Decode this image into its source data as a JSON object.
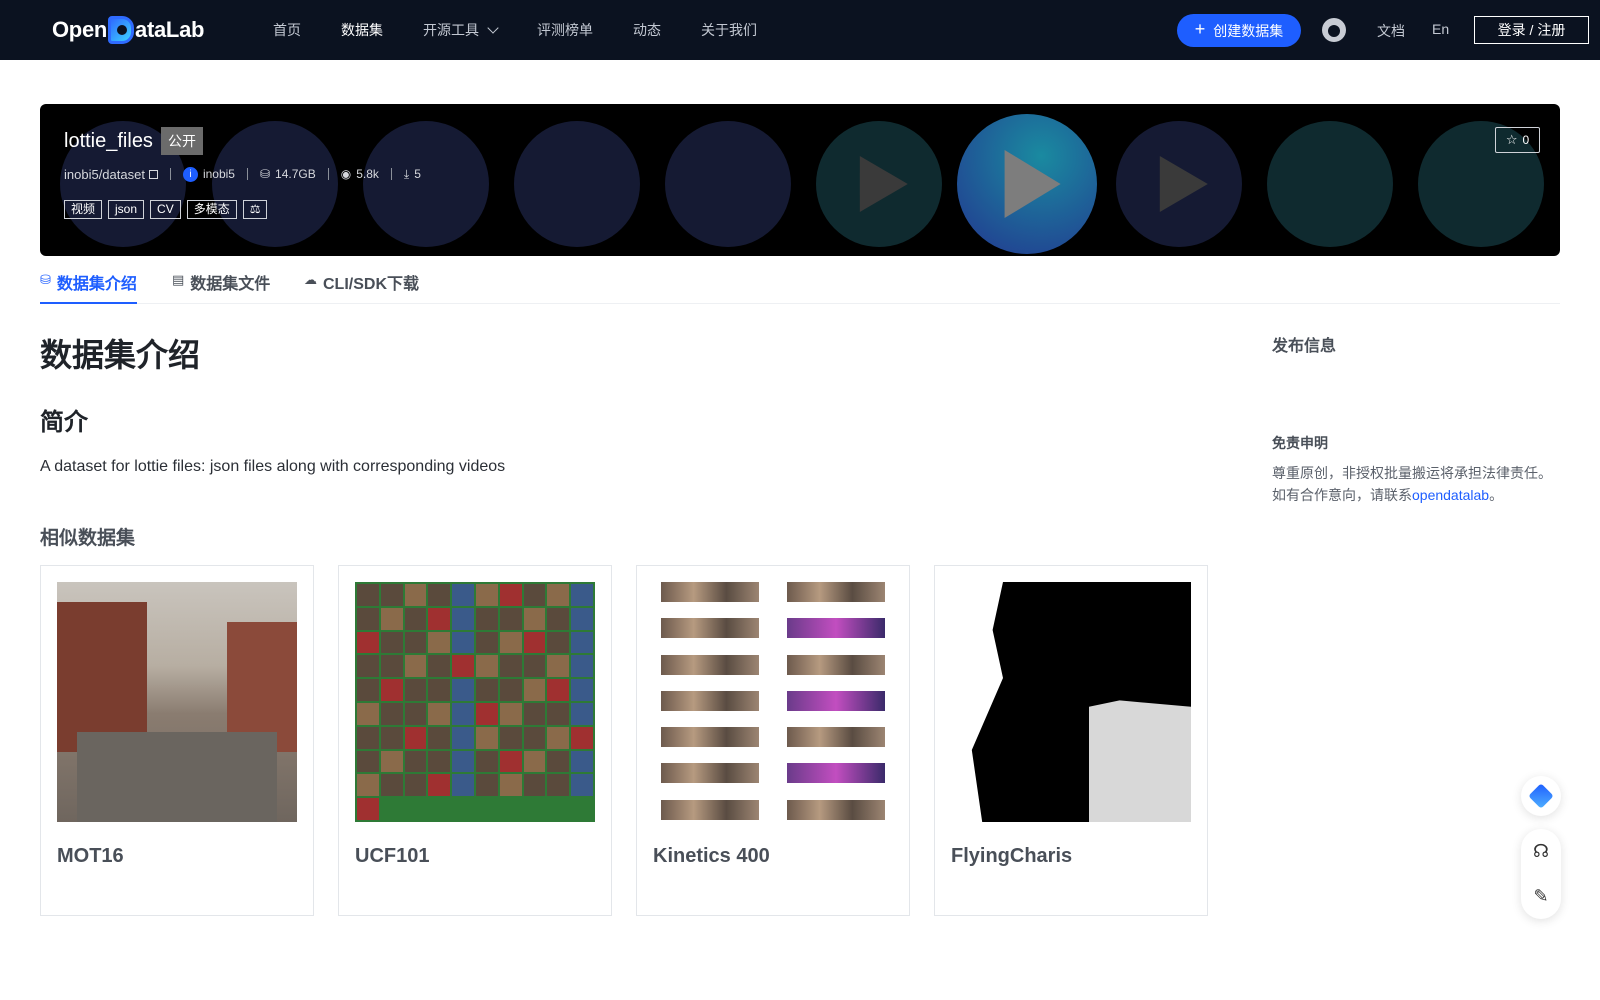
{
  "header": {
    "logo": "OpenDataLab",
    "nav": [
      "首页",
      "数据集",
      "开源工具",
      "评测榜单",
      "动态",
      "关于我们"
    ],
    "create_label": "创建数据集",
    "docs": "文档",
    "lang": "En",
    "login": "登录 / 注册"
  },
  "banner": {
    "title": "lottie_files",
    "visibility": "公开",
    "owner_path": "inobi5/dataset",
    "user": "inobi5",
    "avatar_letter": "i",
    "size": "14.7GB",
    "views": "5.8k",
    "downloads": "5",
    "tags": [
      "视频",
      "json",
      "CV",
      "多模态",
      "⚖"
    ],
    "stars": "0"
  },
  "tabs": [
    "数据集介绍",
    "数据集文件",
    "CLI/SDK下载"
  ],
  "main": {
    "title": "数据集介绍",
    "section": "简介",
    "description": "A dataset for lottie files: json files along with corresponding videos",
    "similar_title": "相似数据集",
    "cards": [
      "MOT16",
      "UCF101",
      "Kinetics 400",
      "FlyingCharis"
    ]
  },
  "sidebar": {
    "publish_info": "发布信息",
    "disclaimer_title": "免责申明",
    "disclaimer_line1": "尊重原创，非授权批量搬运将承担法律责任。",
    "disclaimer_line2_prefix": "如有合作意向，请联系",
    "disclaimer_link": "opendatalab",
    "disclaimer_suffix": "。"
  },
  "colors": {
    "accent": "#1e5eff",
    "header_bg": "#0b1220"
  }
}
